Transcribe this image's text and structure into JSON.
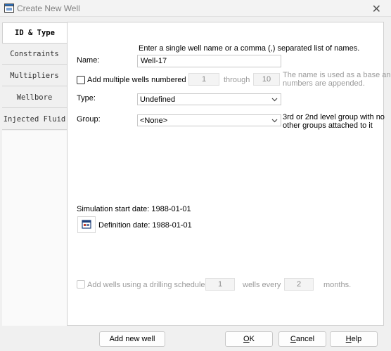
{
  "window": {
    "title": "Create New Well",
    "close_glyph": "✕",
    "icon": "app-window-icon"
  },
  "tabs": [
    {
      "label": "ID & Type",
      "active": true
    },
    {
      "label": "Constraints",
      "active": false
    },
    {
      "label": "Multipliers",
      "active": false
    },
    {
      "label": "Wellbore",
      "active": false
    },
    {
      "label": "Injected Fluid",
      "active": false
    }
  ],
  "form": {
    "instructions": "Enter a single well name or a comma (,) separated list of names.",
    "name_label": "Name:",
    "name_value": "Well-17",
    "multi_label": "Add multiple wells numbered",
    "multi_checked": false,
    "multi_from": "1",
    "through_label": "through",
    "multi_to": "10",
    "multi_note_line1": "The name is used as a base and",
    "multi_note_line2": "numbers are appended.",
    "type_label": "Type:",
    "type_value": "Undefined",
    "group_label": "Group:",
    "group_value": "<None>",
    "group_note_line1": "3rd or 2nd level group with no",
    "group_note_line2": "other groups attached to it",
    "sim_start": "Simulation start date: 1988-01-01",
    "definition_date": "Definition date: 1988-01-01",
    "drill_label": "Add wells using a drilling schedule of",
    "drill_checked": false,
    "drill_count": "1",
    "wells_every_label": "wells every",
    "drill_interval": "2",
    "months_label": "months."
  },
  "buttons": {
    "add_new_well": "Add new well",
    "ok_u": "O",
    "ok_rest": "K",
    "cancel_u": "C",
    "cancel_rest": "ancel",
    "help_u": "H",
    "help_rest": "elp"
  }
}
